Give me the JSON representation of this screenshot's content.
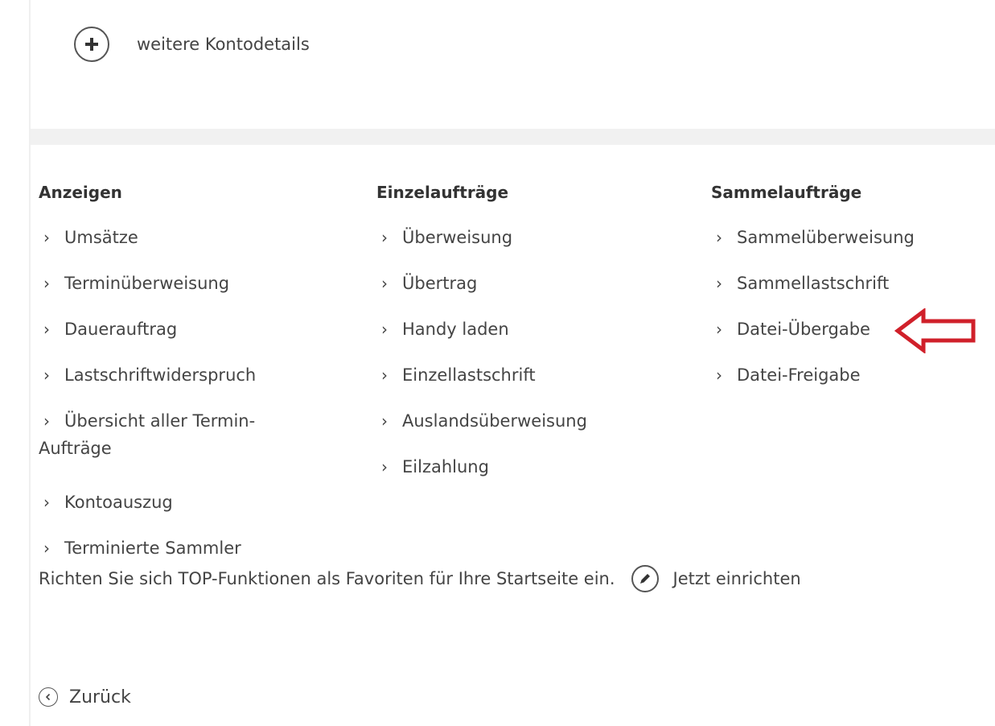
{
  "account": {
    "more_details_label": "weitere Kontodetails",
    "more_details_icon": "plus-circle-icon"
  },
  "columns": [
    {
      "heading": "Anzeigen",
      "items": [
        {
          "label": "Umsätze"
        },
        {
          "label": "Terminüberweisung"
        },
        {
          "label": "Dauerauftrag"
        },
        {
          "label": "Lastschriftwiderspruch"
        },
        {
          "label": "Übersicht aller Termin-Aufträge"
        },
        {
          "label": "Kontoauszug"
        },
        {
          "label": "Terminierte Sammler"
        }
      ]
    },
    {
      "heading": "Einzelaufträge",
      "items": [
        {
          "label": "Überweisung"
        },
        {
          "label": "Übertrag"
        },
        {
          "label": "Handy laden"
        },
        {
          "label": "Einzellastschrift"
        },
        {
          "label": "Auslandsüberweisung"
        },
        {
          "label": "Eilzahlung"
        }
      ]
    },
    {
      "heading": "Sammelaufträge",
      "items": [
        {
          "label": "Sammelüberweisung"
        },
        {
          "label": "Sammellastschrift"
        },
        {
          "label": "Datei-Übergabe"
        },
        {
          "label": "Datei-Freigabe"
        }
      ]
    }
  ],
  "chevron_glyph": "›",
  "favorites": {
    "text": "Richten Sie sich TOP-Funktionen als Favoriten für Ihre Startseite ein.",
    "link_label": "Jetzt einrichten",
    "link_icon": "pencil-circle-icon"
  },
  "back": {
    "label": "Zurück",
    "icon": "chevron-left-circle-icon"
  },
  "annotation": {
    "icon": "red-arrow-icon",
    "color": "#d0202a",
    "points_to": "Datei-Übergabe"
  },
  "colors": {
    "text": "#444444",
    "heading": "#333333",
    "band": "#f1f1f1",
    "accent_arrow": "#d0202a"
  }
}
